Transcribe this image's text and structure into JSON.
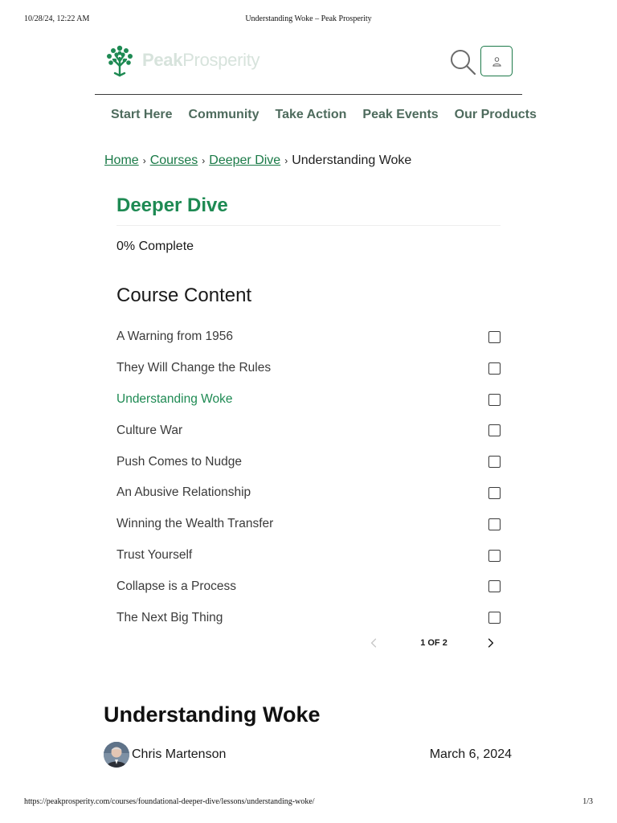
{
  "print_header": {
    "datetime": "10/28/24, 12:22 AM",
    "page_title": "Understanding Woke – Peak Prosperity"
  },
  "print_footer": {
    "url": "https://peakprosperity.com/courses/foundational-deeper-dive/lessons/understanding-woke/",
    "page_number": "1/3"
  },
  "header": {
    "logo_bold": "Peak",
    "logo_light": "Prosperity",
    "logo_icon": "tree-icon",
    "search_icon": "search-icon",
    "account_icon": "user-icon"
  },
  "nav": {
    "items": [
      {
        "label": "Start Here"
      },
      {
        "label": "Community"
      },
      {
        "label": "Take Action"
      },
      {
        "label": "Peak Events"
      },
      {
        "label": "Our Products"
      }
    ]
  },
  "breadcrumb": {
    "home": "Home",
    "courses": "Courses",
    "section": "Deeper Dive",
    "current": "Understanding Woke",
    "separator": "›"
  },
  "course": {
    "title": "Deeper Dive",
    "progress_text": "0% Complete",
    "progress_value": 0,
    "content_heading": "Course Content",
    "lessons": [
      {
        "label": "A Warning from 1956",
        "active": false,
        "completed": false
      },
      {
        "label": "They Will Change the Rules",
        "active": false,
        "completed": false
      },
      {
        "label": "Understanding Woke",
        "active": true,
        "completed": false
      },
      {
        "label": "Culture War",
        "active": false,
        "completed": false
      },
      {
        "label": "Push Comes to Nudge",
        "active": false,
        "completed": false
      },
      {
        "label": "An Abusive Relationship",
        "active": false,
        "completed": false
      },
      {
        "label": "Winning the Wealth Transfer",
        "active": false,
        "completed": false
      },
      {
        "label": "Trust Yourself",
        "active": false,
        "completed": false
      },
      {
        "label": "Collapse is a Process",
        "active": false,
        "completed": false
      },
      {
        "label": "The Next Big Thing",
        "active": false,
        "completed": false
      }
    ],
    "pagination": {
      "label": "1 OF 2",
      "prev_icon": "chevron-left-icon",
      "next_icon": "chevron-right-icon"
    }
  },
  "article": {
    "title": "Understanding Woke",
    "author": "Chris Martenson",
    "date": "March 6, 2024"
  },
  "colors": {
    "brand_green": "#1e8a53",
    "link_green": "#1a7a47",
    "nav_text": "#4e6b5d",
    "logo_faded": "#d7e3dc"
  }
}
